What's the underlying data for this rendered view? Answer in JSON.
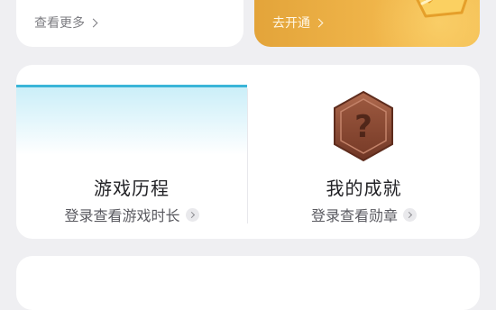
{
  "top_left_card": {
    "more_label": "查看更多"
  },
  "vip_card": {
    "open_label": "去开通"
  },
  "game_history": {
    "title": "游戏历程",
    "subtitle": "登录查看游戏时长"
  },
  "achievements": {
    "title": "我的成就",
    "subtitle": "登录查看勋章",
    "badge_symbol": "?"
  },
  "colors": {
    "page_bg": "#efeff2",
    "vip_gold": "#f0b54a",
    "history_accent": "#3ab5d8",
    "badge_brown": "#8a4a36"
  },
  "icons": {
    "more_chevron": "chevron-right-icon",
    "vip_emblem": "vip-crown-icon",
    "achievement_badge": "question-badge-icon"
  }
}
